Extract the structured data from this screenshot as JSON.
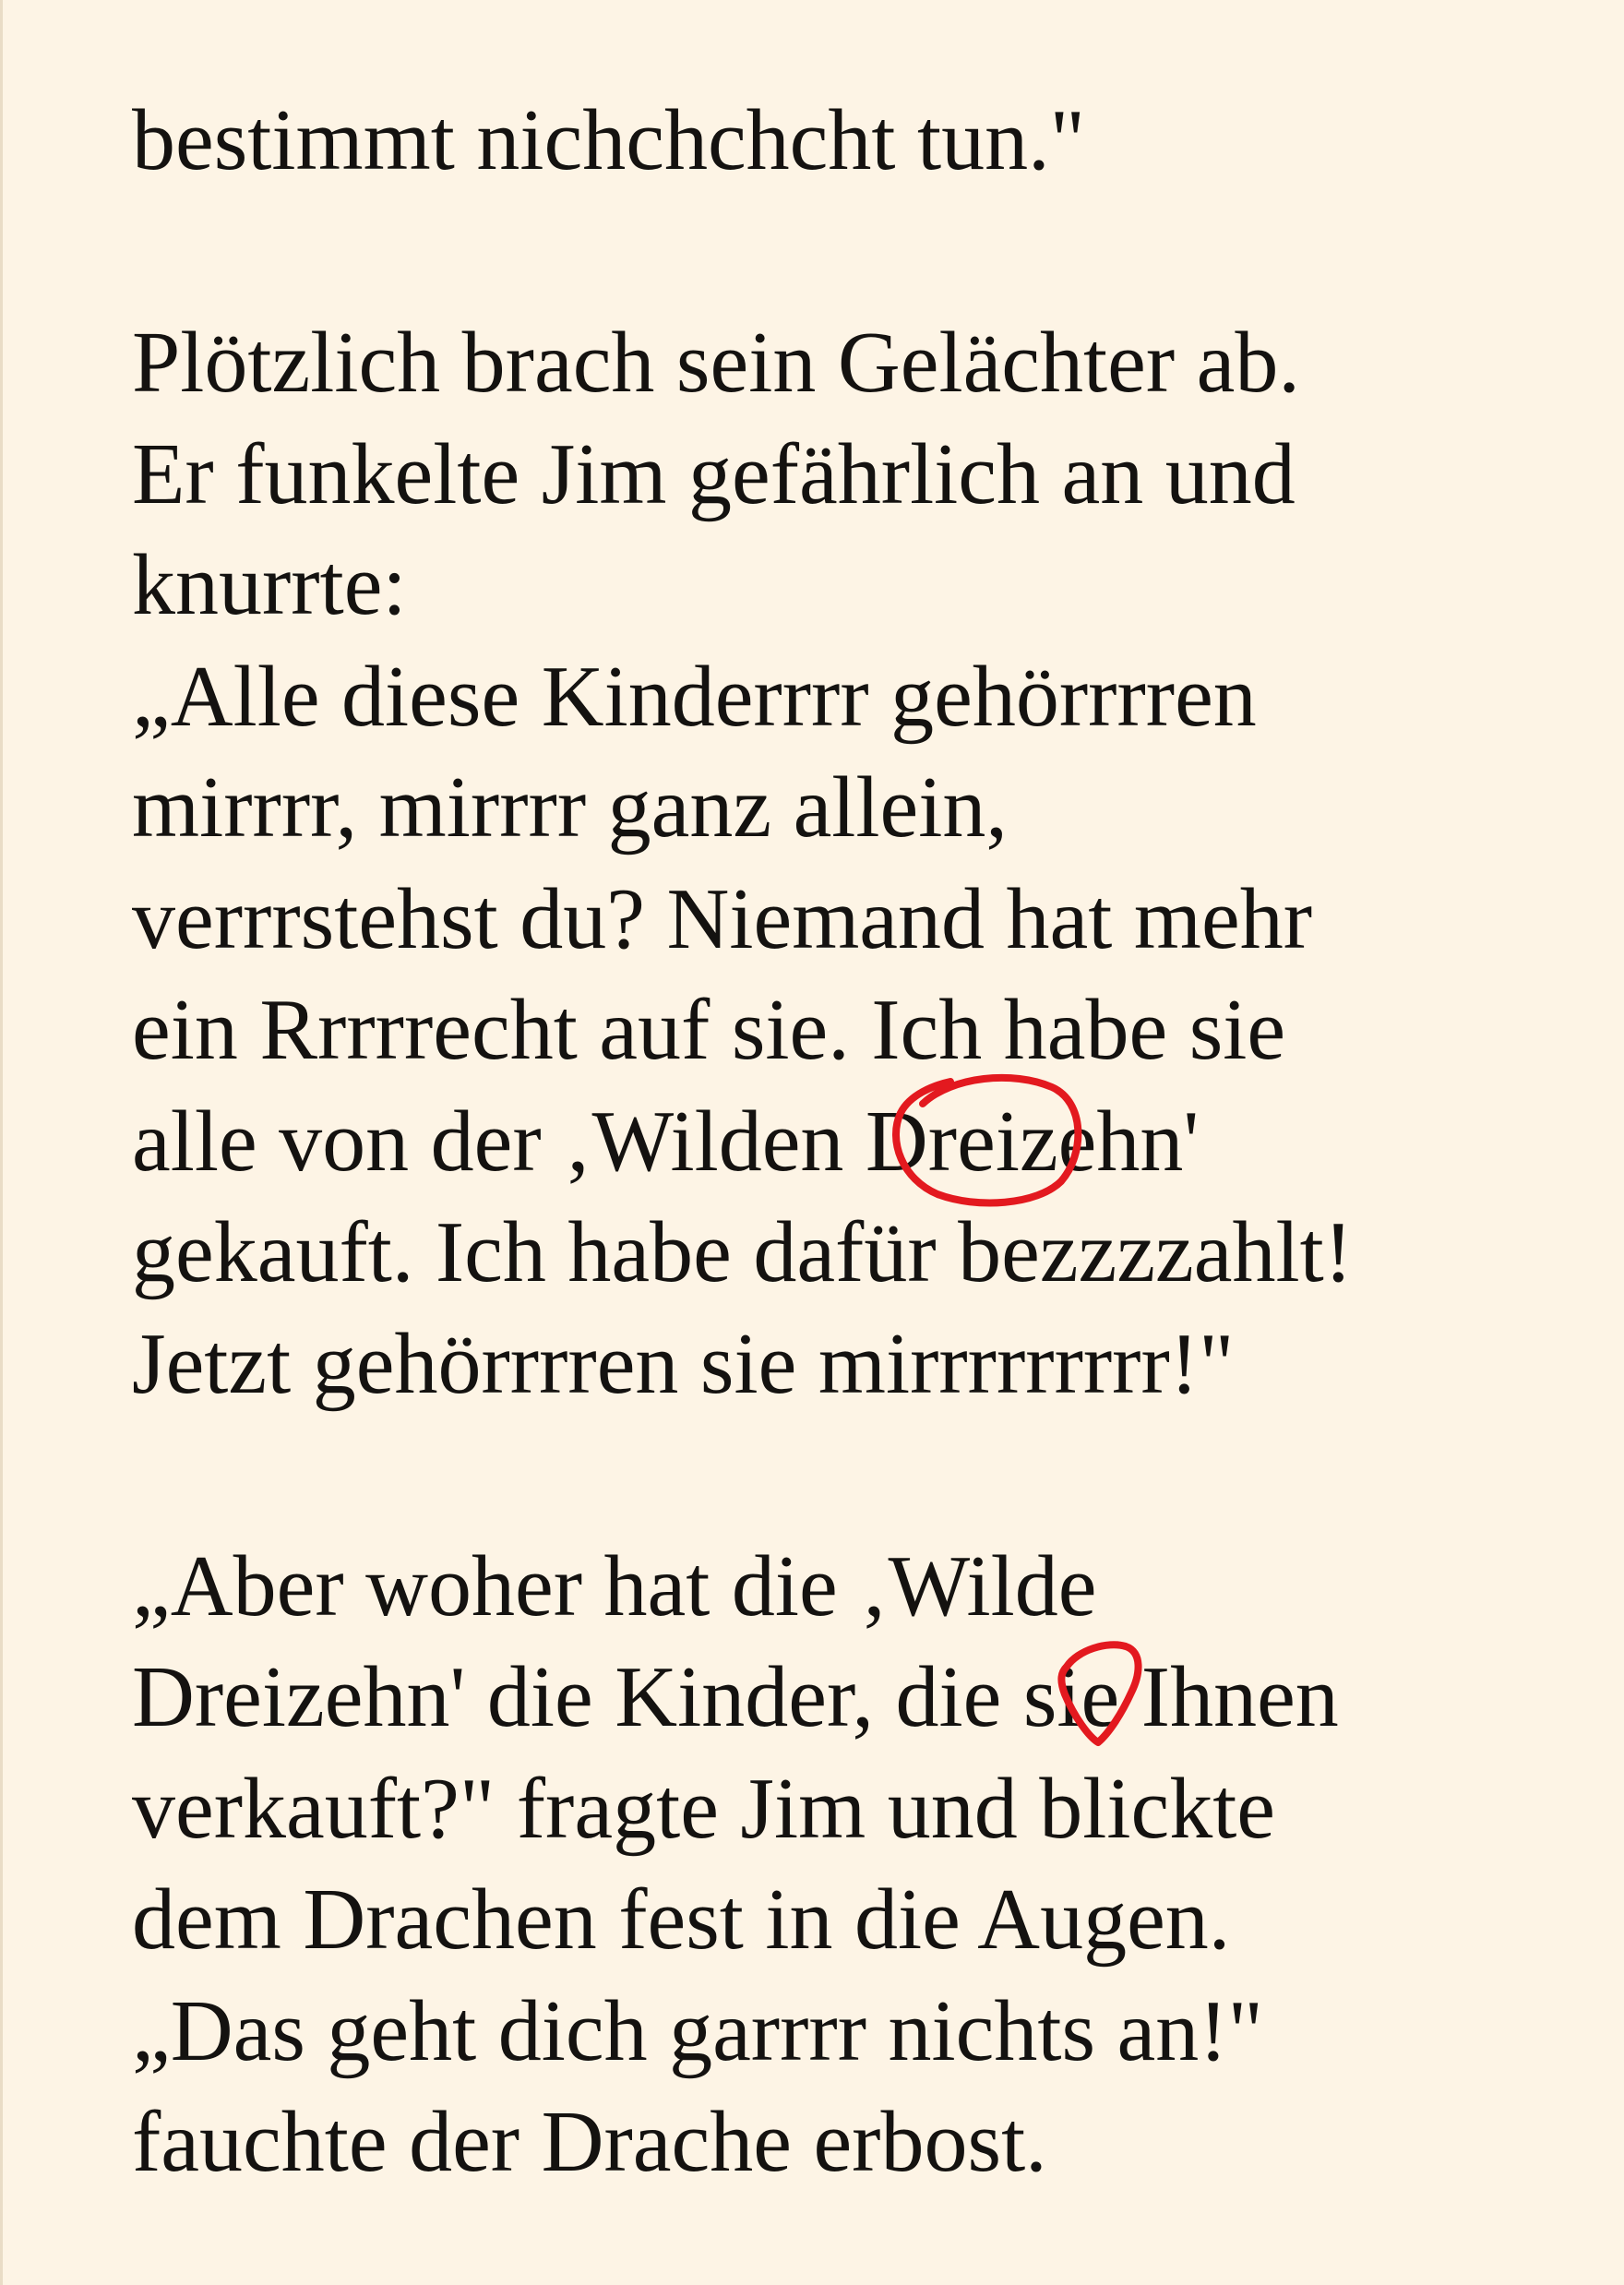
{
  "page": {
    "background_color": "#fdf4e5",
    "text_color": "#141210",
    "annotation_color": "#e3191f",
    "lines": [
      "bestimmt nichchchcht tun.\"",
      "",
      "Plötzlich brach sein Gelächter ab.",
      "Er funkelte Jim gefährlich an und",
      "knurrte:",
      "„Alle diese Kinderrrr gehörrrren",
      "mirrrr, mirrrr ganz allein,",
      "verrrstehst du? Niemand hat mehr",
      "ein Rrrrrecht auf sie. Ich habe sie",
      "alle von der ‚Wilden Dreizehn'",
      "gekauft. Ich habe dafür bezzzzahlt!",
      "Jetzt gehörrrren sie mirrrrrrrrr!\"",
      "",
      "„Aber woher hat die ‚Wilde",
      "Dreizehn' die Kinder, die sie Ihnen",
      "verkauft?\" fragte Jim und blickte",
      "dem Drachen fest in die Augen.",
      "„Das geht dich garrrr nichts an!\"",
      "fauchte der Drache erbost."
    ]
  },
  "annotations": [
    {
      "name": "circle-mark-dreizehn",
      "marked_text": "Drei"
    },
    {
      "name": "circle-mark-sie",
      "marked_text": "si"
    }
  ]
}
